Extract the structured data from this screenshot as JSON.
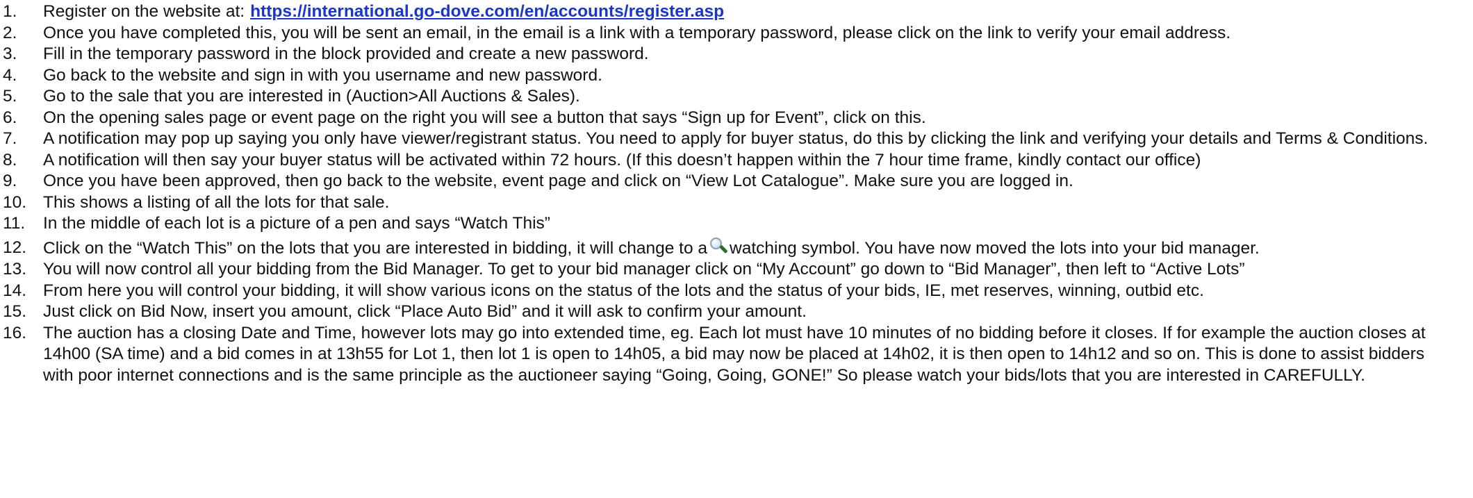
{
  "steps": [
    {
      "num": "1.",
      "text": "Register on the website at:",
      "link": "https://international.go-dove.com/en/accounts/register.asp"
    },
    {
      "num": "2.",
      "text": "Once you have completed this, you will be sent an email, in the email is a link with a temporary password, please click on the link to verify your email address."
    },
    {
      "num": "3.",
      "text": "Fill in the temporary password in the block provided and create a new password."
    },
    {
      "num": "4.",
      "text": "Go back to the website and sign in with you username and new password."
    },
    {
      "num": "5.",
      "text": "Go to the sale that you are interested in (Auction>All Auctions & Sales)."
    },
    {
      "num": "6.",
      "text": "On the opening sales page or event page on the right you will see a button that says “Sign up for Event”, click on this."
    },
    {
      "num": "7.",
      "text": "A notification may pop up saying you only have viewer/registrant status. You need to apply for buyer status, do this by clicking the link and verifying your details and Terms & Conditions."
    },
    {
      "num": "8.",
      "text": "A notification will then say your buyer status will be activated within 72 hours.  (If this doesn’t happen within the 7 hour time frame, kindly contact our office)"
    },
    {
      "num": "9.",
      "text": "Once you have been approved, then go back to the website, event page and click on “View Lot Catalogue”. Make sure you are logged in."
    },
    {
      "num": "10.",
      "text": "This shows a listing of all the lots for that sale."
    },
    {
      "num": "11.",
      "text": "In the middle of each lot is a picture of a pen and says “Watch This”"
    },
    {
      "num": "12.",
      "text_before": "Click on the “Watch This” on the lots that you are interested in bidding, it will change to a",
      "icon": "magnifier-icon",
      "text_after": "watching symbol. You have now moved the lots into your bid manager."
    },
    {
      "num": "13.",
      "text": "You will now control all your bidding from the Bid Manager. To get to your bid manager click on “My Account” go down to “Bid Manager”, then left to “Active Lots”"
    },
    {
      "num": "14.",
      "text": "From here you will control your bidding, it will show various icons on the status of the lots and the status of your bids, IE, met reserves, winning, outbid etc."
    },
    {
      "num": "15.",
      "text": "Just click on Bid Now, insert you amount, click “Place Auto Bid” and it will ask to confirm your amount."
    },
    {
      "num": "16.",
      "text": "The auction has a closing Date and Time, however lots may go into extended time, eg. Each lot must have 10 minutes of no bidding before it closes. If for example the auction closes at 14h00 (SA time) and a bid comes in at 13h55 for Lot 1, then lot 1 is open to 14h05, a bid may now be placed at 14h02, it is then open to 14h12 and so on. This is done to assist bidders with poor internet connections and is the same principle as the auctioneer saying “Going, Going, GONE!”  So please watch your bids/lots that you are interested in CAREFULLY."
    }
  ],
  "colors": {
    "text": "#111111",
    "link": "#1a35c9"
  }
}
